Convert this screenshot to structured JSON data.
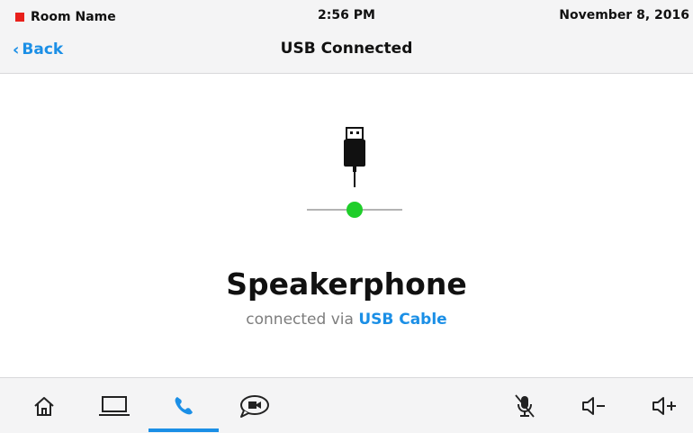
{
  "status_bar": {
    "room_name": "Room Name",
    "time": "2:56 PM",
    "date": "November 8, 2016",
    "room_indicator_color": "#e8201b"
  },
  "header": {
    "back_label": "Back",
    "title": "USB Connected"
  },
  "main": {
    "icon": "usb-plug-icon",
    "status_dot_color": "#1fce2a",
    "device_name": "Speakerphone",
    "connected_prefix": "connected via ",
    "connection_type": "USB Cable"
  },
  "bottom_nav": {
    "items": [
      {
        "icon": "home-icon"
      },
      {
        "icon": "laptop-icon"
      },
      {
        "icon": "phone-icon",
        "active": true
      },
      {
        "icon": "video-chat-icon"
      },
      {
        "icon": "mic-muted-icon"
      },
      {
        "icon": "volume-down-icon"
      },
      {
        "icon": "volume-up-icon"
      }
    ],
    "accent_color": "#1b8fe6"
  }
}
